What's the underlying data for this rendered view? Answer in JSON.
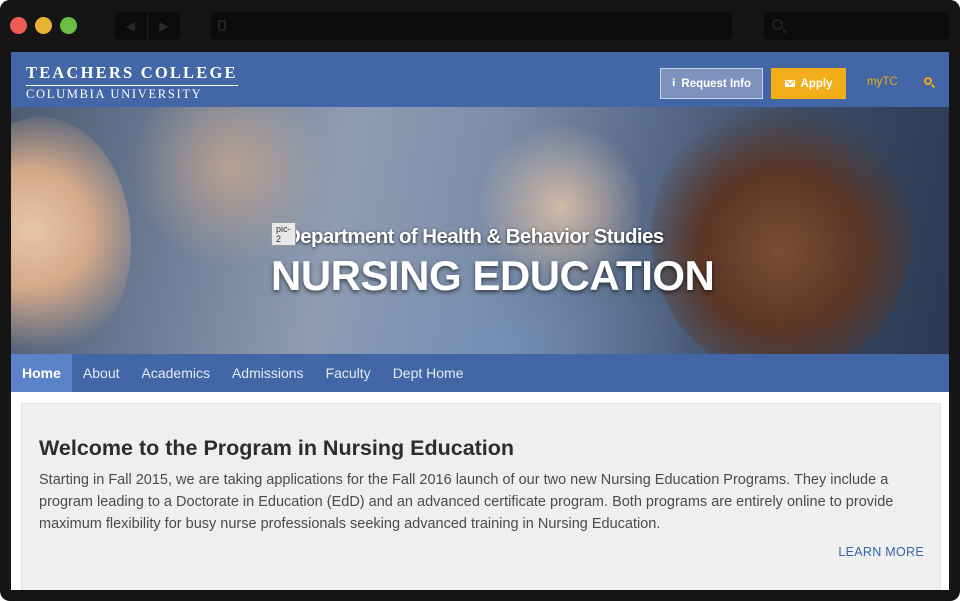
{
  "browser": {
    "back_icon": "back-arrow-icon",
    "forward_icon": "forward-arrow-icon",
    "back_glyph": "◀",
    "forward_glyph": "▶"
  },
  "header": {
    "logo_line1": "TEACHERS COLLEGE",
    "logo_line2": "COLUMBIA UNIVERSITY",
    "request_info_label": "Request Info",
    "apply_label": "Apply",
    "mytc_label": "myTC",
    "info_glyph": "i",
    "brand_color": "#4266a6",
    "accent_color": "#f1ad1a"
  },
  "hero": {
    "pic_label": "pic-2",
    "subtitle": "Department of Health & Behavior Studies",
    "title": "NURSING EDUCATION"
  },
  "nav": {
    "items": [
      "Home",
      "About",
      "Academics",
      "Admissions",
      "Faculty",
      "Dept Home"
    ],
    "active": "Home"
  },
  "content": {
    "title": "Welcome to the Program in Nursing Education",
    "body": "Starting in Fall 2015, we are taking applications for the Fall 2016 launch of our two new Nursing Education Programs.  They include a program leading to a Doctorate in Education (EdD) and an advanced certificate program.  Both programs are entirely online to provide maximum flexibility for busy nurse professionals seeking advanced training in Nursing Education.",
    "learn_more": "LEARN MORE"
  }
}
